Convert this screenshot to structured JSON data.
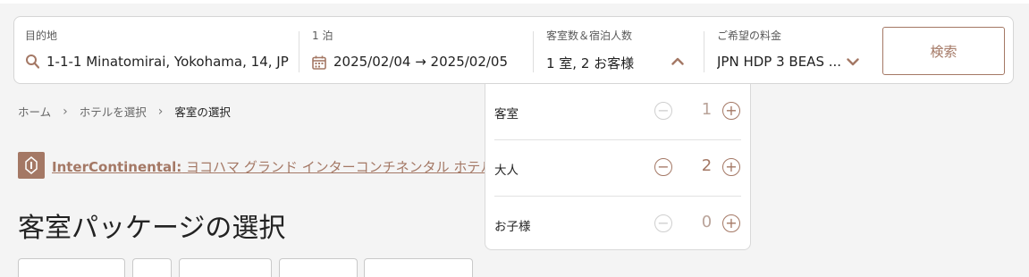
{
  "colors": {
    "accent": "#a47865",
    "text": "#222222",
    "muted_border": "#cfcfcf"
  },
  "search": {
    "destination": {
      "label": "目的地",
      "value": "1-1-1 Minatomirai, Yokohama, 14, JP",
      "icon": "search-icon"
    },
    "dates": {
      "label": "1 泊",
      "value": "2025/02/04 → 2025/02/05",
      "icon": "calendar-icon"
    },
    "guests": {
      "label": "客室数＆宿泊人数",
      "value": "1 室, 2 お客様",
      "icon": "chevron-up-icon"
    },
    "rate": {
      "label": "ご希望の料金",
      "value": "JPN HDP 3 BEAS ...",
      "icon": "chevron-down-icon"
    },
    "button_label": "検索"
  },
  "breadcrumb": {
    "items": [
      "ホーム",
      "ホテルを選択"
    ],
    "current": "客室の選択"
  },
  "hotel": {
    "brand": "InterContinental:",
    "name": " ヨコハマ グランド インターコンチネンタル ホテル"
  },
  "page_title": "客室パッケージの選択",
  "guest_dropdown": {
    "rows": [
      {
        "label": "客室",
        "count": "1",
        "minus_enabled": false,
        "plus_enabled": true
      },
      {
        "label": "大人",
        "count": "2",
        "minus_enabled": true,
        "plus_enabled": true
      },
      {
        "label": "お子様",
        "count": "0",
        "minus_enabled": false,
        "plus_enabled": true
      }
    ],
    "minus_symbol": "−",
    "plus_symbol": "+"
  }
}
